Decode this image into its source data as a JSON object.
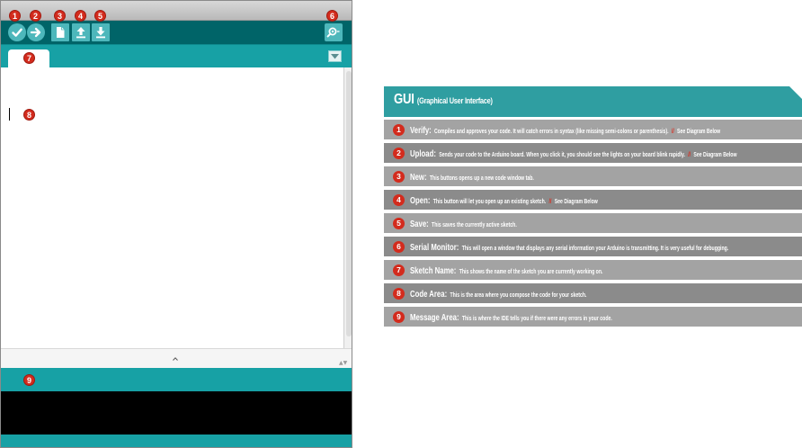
{
  "ide": {
    "markers": {
      "verify": "1",
      "upload": "2",
      "new": "3",
      "open": "4",
      "save": "5",
      "serial_monitor": "6",
      "sketch_name": "7",
      "code_area": "8",
      "message_area": "9"
    },
    "colors": {
      "toolbar": "#006468",
      "tabbar": "#17a1a5",
      "button": "#4db7bb",
      "console": "#000000",
      "marker": "#d32b1d"
    },
    "icons": {
      "verify": "checkmark-icon",
      "upload": "arrow-right-icon",
      "new": "new-file-icon",
      "open": "open-upload-icon",
      "save": "save-download-icon",
      "serial_monitor": "magnifier-icon",
      "tab_menu": "chevron-down-icon"
    }
  },
  "legend": {
    "title": "GUI",
    "subtitle": "(Graphical User Interface)",
    "separator": "//",
    "items": [
      {
        "num": "1",
        "term": "Verify:",
        "desc": "Compiles and approves your code. It will catch errors in syntax (like missing semi-colons or parenthesis).",
        "see": "See Diagram Below"
      },
      {
        "num": "2",
        "term": "Upload:",
        "desc": "Sends your code to the Arduino board. When you click it, you should see the lights on your board blink rapidly.",
        "see": "See Diagram Below"
      },
      {
        "num": "3",
        "term": "New:",
        "desc": "This buttons opens up a new code window tab.",
        "see": ""
      },
      {
        "num": "4",
        "term": "Open:",
        "desc": "This button will let you open up an existing sketch.",
        "see": "See Diagram Below"
      },
      {
        "num": "5",
        "term": "Save:",
        "desc": "This saves the currently active sketch.",
        "see": ""
      },
      {
        "num": "6",
        "term": "Serial Monitor:",
        "desc": "This will open a window that displays any serial information your Arduino is transmitting. It is very useful for debugging.",
        "see": ""
      },
      {
        "num": "7",
        "term": "Sketch Name:",
        "desc": "This shows the name of the sketch you are currently working on.",
        "see": ""
      },
      {
        "num": "8",
        "term": "Code Area:",
        "desc": "This is the area where you compose the code for your sketch.",
        "see": ""
      },
      {
        "num": "9",
        "term": "Message Area:",
        "desc": "This is where the IDE tells you if there were any errors in your code.",
        "see": ""
      }
    ],
    "colors": {
      "header": "#2f9ea1",
      "row_light": "#a3a3a3",
      "row_dark": "#8b8b8b",
      "see_text": "#e0281a"
    }
  }
}
